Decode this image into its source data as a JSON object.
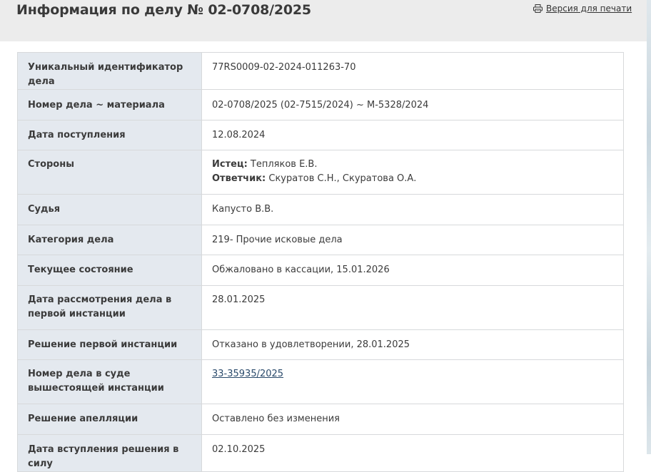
{
  "header": {
    "title": "Информация по делу № 02-0708/2025",
    "print_label": "Версия для печати",
    "print_icon": "printer-icon"
  },
  "case": {
    "uid": {
      "label": "Уникальный идентификатор дела",
      "value": "77RS0009-02-2024-011263-70"
    },
    "number": {
      "label": "Номер дела ~ материала",
      "value": "02-0708/2025 (02-7515/2024) ~ М-5328/2024"
    },
    "received": {
      "label": "Дата поступления",
      "value": "12.08.2024"
    },
    "parties": {
      "label": "Стороны",
      "plaintiff_role": "Истец:",
      "plaintiff": "Тепляков Е.В.",
      "defendant_role": "Ответчик:",
      "defendant": "Скуратов С.Н., Скуратова О.А."
    },
    "judge": {
      "label": "Судья",
      "value": "Капусто В.В."
    },
    "category": {
      "label": "Категория дела",
      "value": "219- Прочие исковые дела"
    },
    "status": {
      "label": "Текущее состояние",
      "value": "Обжаловано в кассации, 15.01.2026"
    },
    "first_hearing": {
      "label": "Дата рассмотрения дела в первой инстанции",
      "value": "28.01.2025"
    },
    "first_decision": {
      "label": "Решение первой инстанции",
      "value": "Отказано в удовлетворении, 28.01.2025"
    },
    "higher_number": {
      "label": "Номер дела в суде вышестоящей инстанции",
      "value": "33-35935/2025"
    },
    "appeal": {
      "label": "Решение апелляции",
      "value": "Оставлено без изменения"
    },
    "effective": {
      "label": "Дата вступления решения в силу",
      "value": "02.10.2025"
    }
  }
}
